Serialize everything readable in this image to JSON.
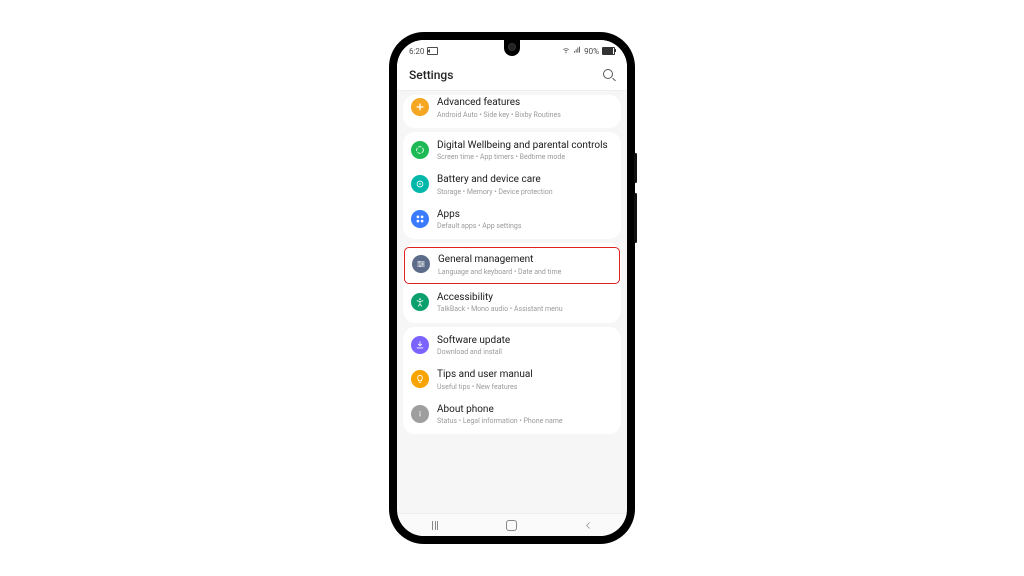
{
  "statusbar": {
    "time": "6:20",
    "battery_text": "90%"
  },
  "header": {
    "title": "Settings"
  },
  "groups": [
    {
      "items": [
        {
          "key": "advanced",
          "title": "Advanced features",
          "subtitle": "Android Auto  •  Side key  •  Bixby Routines",
          "partial": true
        }
      ]
    },
    {
      "items": [
        {
          "key": "wellbeing",
          "title": "Digital Wellbeing and parental controls",
          "subtitle": "Screen time  •  App timers  •  Bedtime mode"
        },
        {
          "key": "battery",
          "title": "Battery and device care",
          "subtitle": "Storage  •  Memory  •  Device protection"
        },
        {
          "key": "apps",
          "title": "Apps",
          "subtitle": "Default apps  •  App settings"
        }
      ]
    },
    {
      "highlight": 0,
      "items": [
        {
          "key": "general",
          "title": "General management",
          "subtitle": "Language and keyboard  •  Date and time"
        },
        {
          "key": "accessibility",
          "title": "Accessibility",
          "subtitle": "TalkBack  •  Mono audio  •  Assistant menu"
        }
      ]
    },
    {
      "items": [
        {
          "key": "software",
          "title": "Software update",
          "subtitle": "Download and install"
        },
        {
          "key": "tips",
          "title": "Tips and user manual",
          "subtitle": "Useful tips  •  New features"
        },
        {
          "key": "about",
          "title": "About phone",
          "subtitle": "Status  •  Legal information  •  Phone name"
        }
      ]
    }
  ],
  "icons": {
    "advanced": "plus-badge-icon",
    "wellbeing": "wellbeing-icon",
    "battery": "device-care-icon",
    "apps": "apps-grid-icon",
    "general": "sliders-icon",
    "accessibility": "accessibility-icon",
    "software": "download-icon",
    "tips": "lightbulb-icon",
    "about": "info-icon"
  }
}
